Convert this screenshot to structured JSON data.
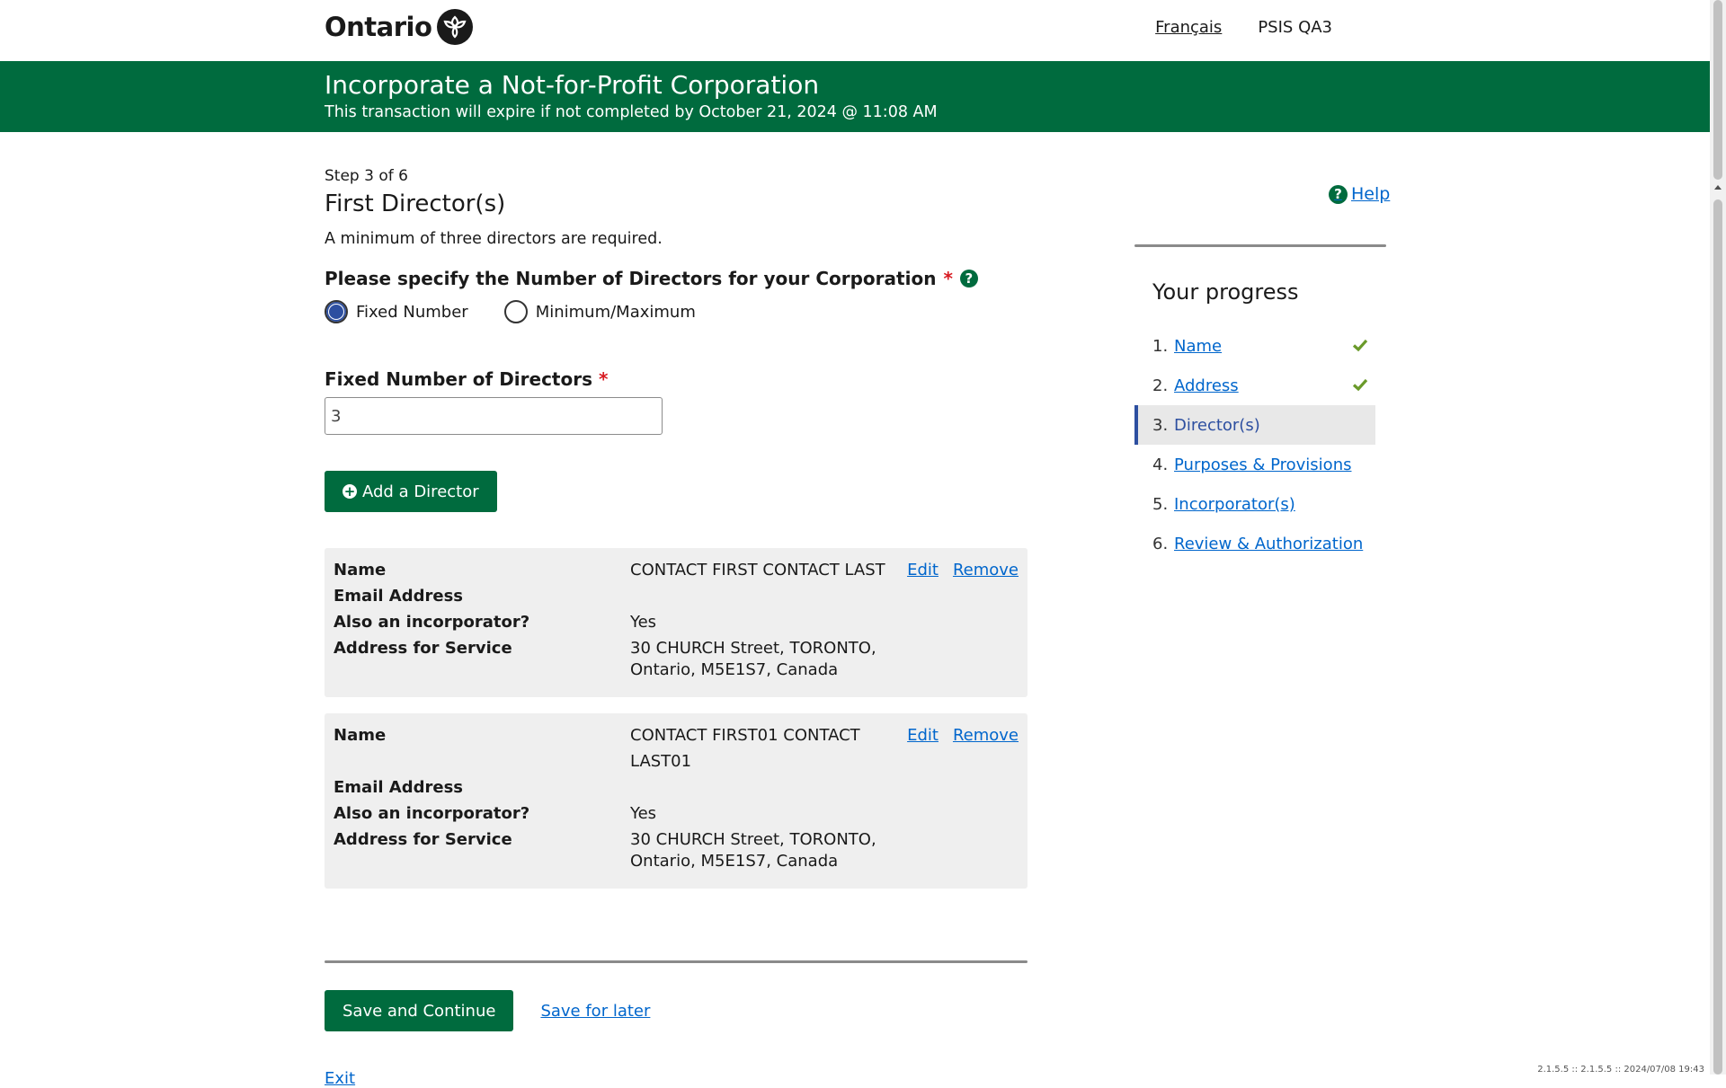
{
  "header": {
    "logo_text": "Ontario",
    "lang_link": "Français",
    "env_label": "PSIS QA3"
  },
  "banner": {
    "title": "Incorporate a Not-for-Profit Corporation",
    "subtitle": "This transaction will expire if not completed by October 21, 2024 @ 11:08 AM"
  },
  "main": {
    "step": "Step 3 of 6",
    "title": "First Director(s)",
    "note": "A minimum of three directors are required.",
    "question": "Please specify the Number of Directors for your Corporation",
    "required_mark": "*",
    "help_mark": "?",
    "radio_options": [
      {
        "label": "Fixed Number",
        "selected": true
      },
      {
        "label": "Minimum/Maximum",
        "selected": false
      }
    ],
    "fixed_label": "Fixed Number of Directors",
    "fixed_value": "3",
    "add_button": "Add a Director",
    "add_icon": "+",
    "directors": [
      {
        "labels": {
          "name": "Name",
          "email": "Email Address",
          "incorporator": "Also an incorporator?",
          "address": "Address for Service"
        },
        "name": "CONTACT FIRST CONTACT LAST",
        "email": "",
        "incorporator": "Yes",
        "address_line1": "30 CHURCH Street, TORONTO,",
        "address_line2": "Ontario, M5E1S7, Canada",
        "edit": "Edit",
        "remove": "Remove"
      },
      {
        "labels": {
          "name": "Name",
          "email": "Email Address",
          "incorporator": "Also an incorporator?",
          "address": "Address for Service"
        },
        "name": "CONTACT FIRST01 CONTACT LAST01",
        "email": "",
        "incorporator": "Yes",
        "address_line1": "30 CHURCH Street, TORONTO,",
        "address_line2": "Ontario, M5E1S7, Canada",
        "edit": "Edit",
        "remove": "Remove"
      }
    ],
    "save_continue": "Save and Continue",
    "save_later": "Save for later",
    "exit": "Exit"
  },
  "sidebar": {
    "help": "Help",
    "help_mark": "?",
    "title": "Your progress",
    "items": [
      {
        "num": "1.",
        "label": "Name",
        "status": "complete"
      },
      {
        "num": "2.",
        "label": "Address",
        "status": "complete"
      },
      {
        "num": "3.",
        "label": "Director(s)",
        "status": "current"
      },
      {
        "num": "4.",
        "label": "Purposes & Provisions",
        "status": "todo"
      },
      {
        "num": "5.",
        "label": "Incorporator(s)",
        "status": "todo"
      },
      {
        "num": "6.",
        "label": "Review & Authorization",
        "status": "todo"
      }
    ]
  },
  "footer": {
    "version": "2.1.5.5 :: 2.1.5.5 :: 2024/07/08 19:43"
  },
  "colors": {
    "brand_green": "#006b3e",
    "link_blue": "#0066cc",
    "active_blue": "#2d4fa0",
    "required_red": "#d81a21",
    "check_green": "#6a9a2a"
  },
  "icons": [
    "ontario-trillium-icon",
    "help-icon",
    "plus-circle-icon",
    "check-icon"
  ]
}
